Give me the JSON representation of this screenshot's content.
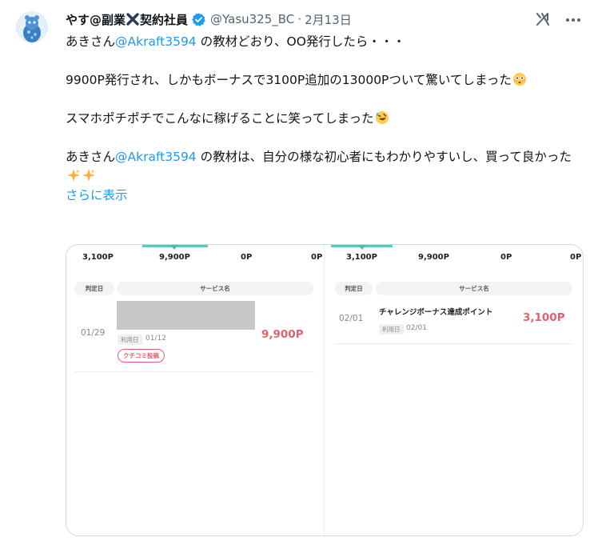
{
  "user": {
    "name_part1": "やす@副業",
    "name_part2": "契約社員",
    "handle": "@Yasu325_BC",
    "separator": "·",
    "date": "2月13日"
  },
  "tweet": {
    "line1_prefix": "あきさん",
    "mention1": "@Akraft3594",
    "line1_suffix": " の教材どおり、OO発行したら・・・",
    "line2": "9900P発行され、しかもボーナスで3100P追加の13000Pついて驚いてしまった",
    "line3": "スマホポチポチでこんなに稼げることに笑ってしまった",
    "line4_prefix": "あきさん",
    "mention2": "@Akraft3594",
    "line4_suffix": " の教材は、自分の様な初心者にもわかりやすいし、買って良かった",
    "show_more": "さらに表示"
  },
  "icons": {
    "verified": "verified-badge-icon",
    "cross": "cross-mark-icon",
    "grok": "grok-icon",
    "more": "more-options-icon",
    "emoji1": "flushed-face-emoji",
    "emoji2": "rofl-emoji",
    "emoji3": "sparkles-emoji"
  },
  "media_left": {
    "tabs": [
      "3,100P",
      "9,900P",
      "0P",
      "0P"
    ],
    "col_date": "判定日",
    "col_service": "サービス名",
    "row_date": "01/29",
    "use_label": "利用日",
    "use_date": "01/12",
    "amount": "9,900P",
    "badge": "クチコミ投稿"
  },
  "media_right": {
    "tabs": [
      "3,100P",
      "9,900P",
      "0P",
      "0P"
    ],
    "col_date": "判定日",
    "col_service": "サービス名",
    "row_date": "02/01",
    "service": "チャレンジボーナス達成ポイント",
    "use_label": "利用日",
    "use_date": "02/01",
    "amount": "3,100P"
  },
  "colors": {
    "link": "#1d9bf0",
    "verified": "#1d9bf0",
    "points_red": "#e0626f",
    "tab_accent": "#59c9b8"
  }
}
